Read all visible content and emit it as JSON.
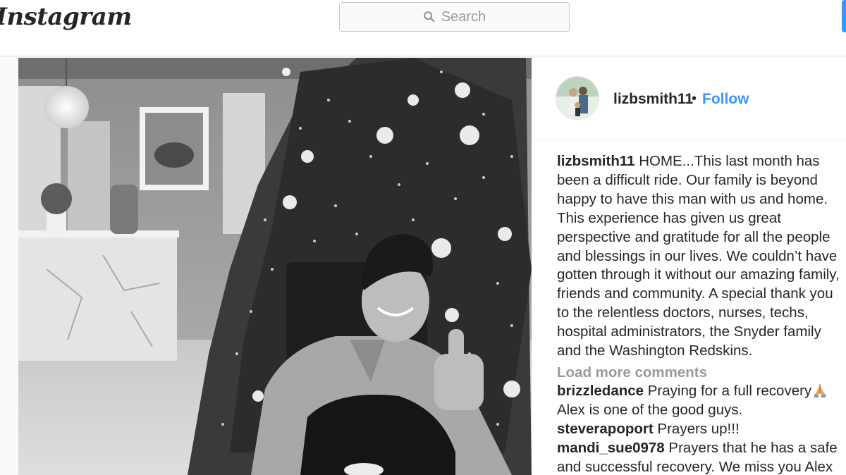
{
  "app": {
    "logo_text": "Instagram"
  },
  "search": {
    "placeholder": "Search",
    "icon": "search-icon"
  },
  "post": {
    "username": "lizbsmith11",
    "separator": "•",
    "follow_label": "Follow",
    "caption": {
      "username": "lizbsmith11",
      "text": "HOME...This last month has been a difficult ride. Our family is beyond happy to have this man with us and home. This experience has given us great perspective and gratitude for all the people and blessings in our lives. We couldn’t have gotten through it without our amazing family, friends and community. A special thank you to the relentless doctors, nurses, techs, hospital administrators, the Snyder family and the Washington Redskins."
    },
    "load_more_label": "Load more comments",
    "comments": [
      {
        "username": "brizzledance",
        "text": "Praying for a full recovery",
        "emoji": "folded-hands-icon",
        "line2": "Alex is one of the good guys."
      },
      {
        "username": "steverapoport",
        "text": "Prayers up!!!"
      },
      {
        "username": "mandi_sue0978",
        "text": "Prayers that he has a safe and successful recovery. We miss you Alex"
      }
    ]
  }
}
